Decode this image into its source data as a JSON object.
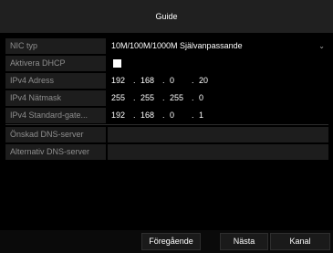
{
  "window": {
    "title": "Guide"
  },
  "form": {
    "nic_type": {
      "label": "NIC typ",
      "value": "10M/100M/1000M Självanpassande"
    },
    "dhcp": {
      "label": "Aktivera DHCP",
      "checked": false
    },
    "ipv4_address": {
      "label": "IPv4 Adress",
      "octets": [
        "192",
        "168",
        "0",
        "20"
      ]
    },
    "ipv4_netmask": {
      "label": "IPv4 Nätmask",
      "octets": [
        "255",
        "255",
        "255",
        "0"
      ]
    },
    "ipv4_gateway": {
      "label": "IPv4 Standard-gate...",
      "octets": [
        "192",
        "168",
        "0",
        "1"
      ]
    },
    "preferred_dns": {
      "label": "Önskad DNS-server",
      "value": ""
    },
    "alternate_dns": {
      "label": "Alternativ DNS-server",
      "value": ""
    }
  },
  "buttons": {
    "previous": "Föregående",
    "next": "Nästa",
    "channel": "Kanal"
  }
}
